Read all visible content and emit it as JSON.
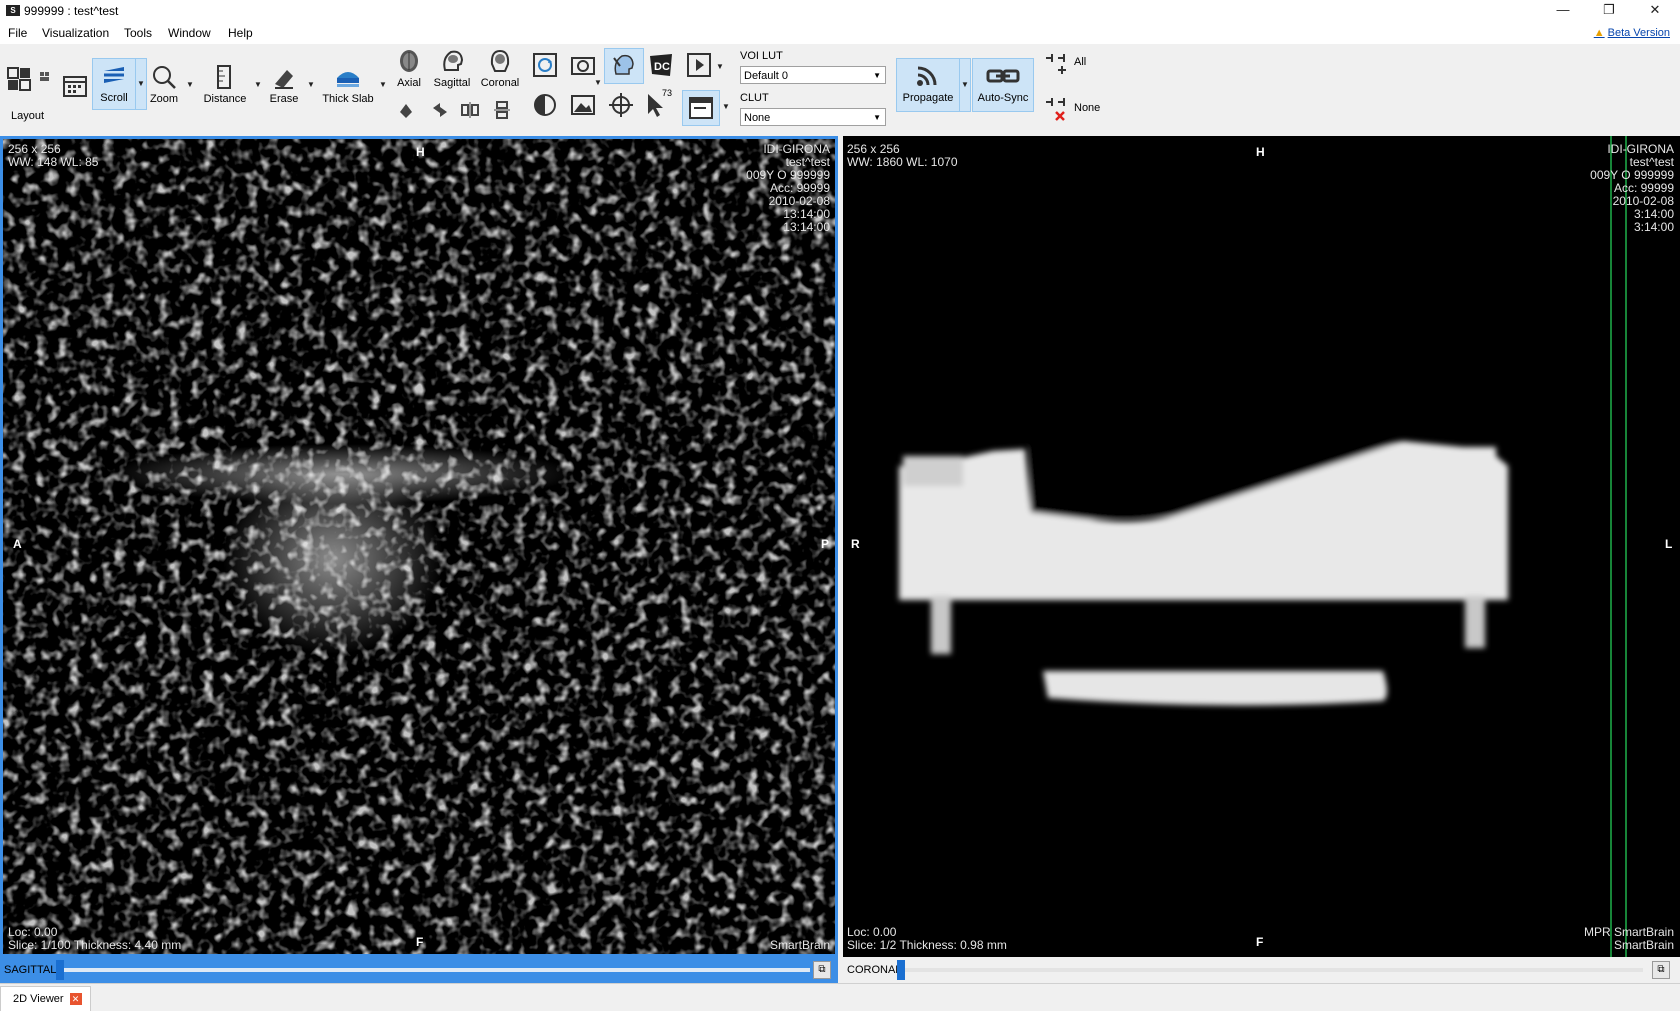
{
  "window": {
    "title": "999999 : test^test",
    "icon": "app-logo-icon",
    "app_icon_text": "S"
  },
  "window_controls": {
    "minimize": "—",
    "restore": "❐",
    "close": "✕"
  },
  "menu": {
    "items": [
      "File",
      "Visualization",
      "Tools",
      "Window",
      "Help"
    ],
    "beta": "Beta Version",
    "beta_icon": "warning-icon"
  },
  "toolbar": {
    "layout": "Layout",
    "scroll": "Scroll",
    "zoom": "Zoom",
    "distance": "Distance",
    "erase": "Erase",
    "thick_slab": "Thick Slab",
    "axial": "Axial",
    "sagittal": "Sagittal",
    "coronal": "Coronal",
    "dicom_badge": "DC",
    "cursor_count": "73",
    "voi_lut_label": "VOI LUT",
    "voi_lut_value": "Default 0",
    "clut_label": "CLUT",
    "clut_value": "None",
    "propagate": "Propagate",
    "auto_sync": "Auto-Sync",
    "all": "All",
    "none": "None"
  },
  "viewer_left": {
    "dims": "256 x 256",
    "window": "WW: 148 WL: 85",
    "institution": "IDI-GIRONA",
    "patient": "test^test",
    "patient_id": "009Y O 999999",
    "acc": "Acc: 99999",
    "date": "2010-02-08",
    "time1": "13:14:00",
    "time2": "13:14:00",
    "loc": "Loc: 0.00",
    "slice": "Slice: 1/100 Thickness: 4.40 mm",
    "series": "SmartBrain",
    "top": "H",
    "bottom": "F",
    "left": "A",
    "right": "P",
    "plane": "SAGITTAL"
  },
  "viewer_right": {
    "dims": "256 x 256",
    "window": "WW: 1860 WL: 1070",
    "institution": "IDI-GIRONA",
    "patient": "test^test",
    "patient_id": "009Y O 999999",
    "acc": "Acc: 99999",
    "date": "2010-02-08",
    "time1": "3:14:00",
    "time2": "3:14:00",
    "loc": "Loc: 0.00",
    "slice": "Slice: 1/2 Thickness: 0.98 mm",
    "series_mpr": "MPR SmartBrain",
    "series": "SmartBrain",
    "top": "H",
    "bottom": "F",
    "left": "R",
    "right": "L",
    "plane": "CORONAL"
  },
  "bottom_tab": {
    "label": "2D Viewer",
    "close": "✕"
  },
  "colors": {
    "accent": "#3c8ee6",
    "selected": "#cde4f7",
    "slider": "#1a6fd1",
    "refline": "#1fb14a"
  }
}
